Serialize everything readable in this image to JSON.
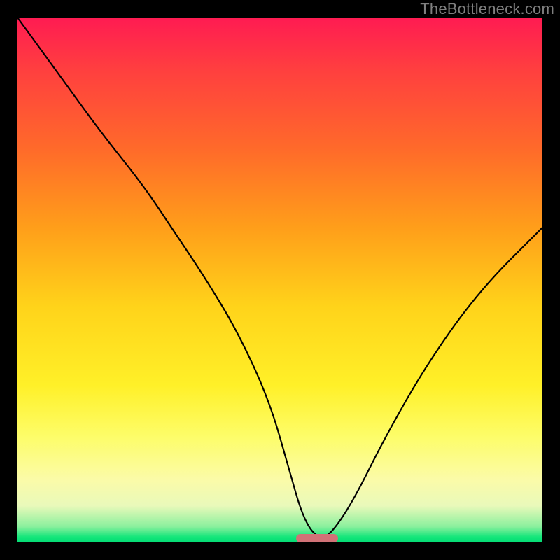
{
  "watermark": "TheBottleneck.com",
  "chart_data": {
    "type": "line",
    "title": "",
    "xlabel": "",
    "ylabel": "",
    "xlim": [
      0,
      100
    ],
    "ylim": [
      0,
      100
    ],
    "grid": false,
    "background": "vertical red-to-green gradient",
    "series": [
      {
        "name": "bottleneck-curve",
        "color": "#000000",
        "x": [
          0,
          8,
          16,
          24,
          30,
          36,
          42,
          48,
          52,
          54,
          56,
          58,
          60,
          64,
          70,
          78,
          88,
          100
        ],
        "y": [
          100,
          89,
          78,
          68,
          59,
          50,
          40,
          27,
          13,
          6,
          2,
          0.8,
          2,
          8,
          20,
          34,
          48,
          60
        ]
      }
    ],
    "marker": {
      "name": "optimal-range",
      "color": "#d17277",
      "x_start": 53,
      "x_end": 61,
      "y": 0.5
    }
  }
}
